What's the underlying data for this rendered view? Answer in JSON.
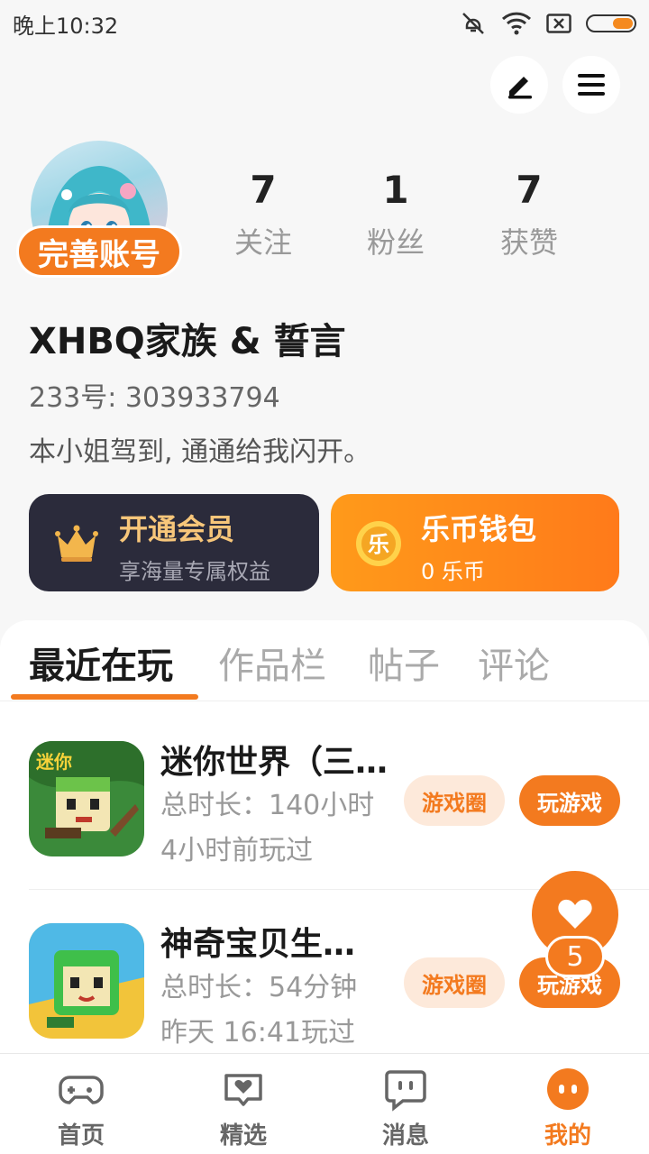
{
  "status_bar": {
    "time": "晚上10:32",
    "battery_level": 0.45
  },
  "profile": {
    "complete_label": "完善账号",
    "stats": [
      {
        "num": "7",
        "label": "关注"
      },
      {
        "num": "1",
        "label": "粉丝"
      },
      {
        "num": "7",
        "label": "获赞"
      }
    ],
    "username": "XHBQ家族 & 誓言",
    "uid": "233号: 303933794",
    "bio": "本小姐驾到, 通通给我闪开。"
  },
  "cards": {
    "vip": {
      "title": "开通会员",
      "subtitle": "享海量专属权益"
    },
    "wallet": {
      "title": "乐币钱包",
      "subtitle": "0 乐币",
      "coin_glyph": "乐"
    }
  },
  "tabs": [
    "最近在玩",
    "作品栏",
    "帖子",
    "评论"
  ],
  "games": [
    {
      "name": "迷你世界（三…",
      "total_time": "总时长：140小时",
      "last_played": "4小时前玩过",
      "circle_label": "游戏圈",
      "play_label": "玩游戏"
    },
    {
      "name": "神奇宝贝生…",
      "total_time": "总时长：54分钟",
      "last_played": "昨天 16:41玩过",
      "circle_label": "游戏圈",
      "play_label": "玩游戏"
    }
  ],
  "float_like": {
    "count": "5"
  },
  "bottom_nav": [
    {
      "label": "首页",
      "icon": "gamepad-icon"
    },
    {
      "label": "精选",
      "icon": "heart-chat-icon"
    },
    {
      "label": "消息",
      "icon": "message-icon"
    },
    {
      "label": "我的",
      "icon": "profile-face-icon"
    }
  ],
  "colors": {
    "accent": "#f37a1f",
    "vip_bg": "#2b2b3b",
    "vip_gold": "#f7c67a"
  }
}
